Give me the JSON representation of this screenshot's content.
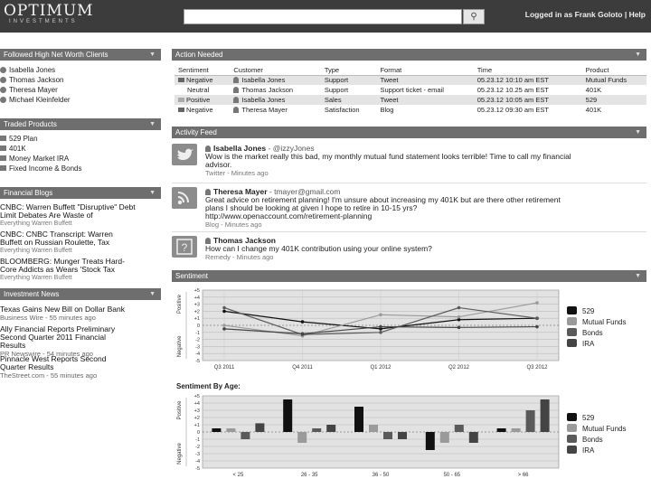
{
  "header": {
    "logo_main": "OPTIMUM",
    "logo_sub": "INVESTMENTS",
    "search_placeholder": "",
    "search_icon": "search-icon",
    "login_text": "Logged in as Frank Goloto | Help"
  },
  "followed_clients": {
    "title": "Followed High Net Worth Clients",
    "items": [
      "Isabella Jones",
      "Thomas Jackson",
      "Theresa Mayer",
      "Michael Kleinfelder"
    ]
  },
  "traded_products": {
    "title": "Traded Products",
    "items": [
      "529 Plan",
      "401K",
      "Money Market IRA",
      "Fixed Income & Bonds"
    ]
  },
  "financial_blogs": {
    "title": "Financial Blogs",
    "items": [
      {
        "title": "CNBC: Warren Buffett \"Disruptive\" Debt",
        "title2": "Limit Debates Are Waste of",
        "source": "Everything Warren Buffett"
      },
      {
        "title": "CNBC: CNBC Transcript: Warren",
        "title2": "Buffett on Russian Roulette, Tax",
        "source": "Everything Warren Buffett"
      },
      {
        "title": "BLOOMBERG: Munger Treats Hard-",
        "title2": "Core Addicts as Wears 'Stock Tax",
        "source": "Everything Warren Buffett"
      }
    ]
  },
  "investment_news": {
    "title": "Investment News",
    "items": [
      {
        "title": "Texas Gains New Bill on Dollar Bank",
        "title2": "",
        "title3": "",
        "source": "Business Wire",
        "time": "55 minutes ago"
      },
      {
        "title": "Ally Financial Reports Preliminary",
        "title2": "Second Quarter 2011 Financial",
        "title3": "Results",
        "source": "PR Newswire",
        "time": "54 minutes ago"
      },
      {
        "title": "Pinnacle West Reports Second",
        "title2": "Quarter Results",
        "title3": "",
        "source": "TheStreet.com",
        "time": "55 minutes ago"
      }
    ]
  },
  "action_needed": {
    "title": "Action Needed",
    "columns": [
      "Sentiment",
      "Customer",
      "Type",
      "Format",
      "Time",
      "Product"
    ],
    "rows": [
      {
        "sentiment": "Negative",
        "customer": "Isabella Jones",
        "type": "Support",
        "format": "Tweet",
        "time": "05.23.12 10:10 am EST",
        "product": "Mutual Funds"
      },
      {
        "sentiment": "Neutral",
        "customer": "Thomas Jackson",
        "type": "Support",
        "format": "Support ticket - email",
        "time": "05.23.12 10.25 am EST",
        "product": "401K"
      },
      {
        "sentiment": "Positive",
        "customer": "Isabella Jones",
        "type": "Sales",
        "format": "Tweet",
        "time": "05.23.12 10:05 am EST",
        "product": "529"
      },
      {
        "sentiment": "Negative",
        "customer": "Theresa Mayer",
        "type": "Satisfaction",
        "format": "Blog",
        "time": "05.23.12 09:30 am EST",
        "product": "401K"
      }
    ]
  },
  "activity_feed": {
    "title": "Activity Feed",
    "items": [
      {
        "name": "Isabella Jones",
        "handle": "- @izzyJones",
        "line1": "Wow is the market really this bad, my monthly mutual fund statement looks terrible! Time to call my financial",
        "line2": "advisor.",
        "line3": "",
        "source": "Twitter",
        "time": "Minutes ago",
        "icon": "twitter-icon"
      },
      {
        "name": "Theresa Mayer",
        "handle": "- tmayer@gmail.com",
        "line1": "Great advice on retirement planning! I'm unsure about increasing my 401K but are there other retirement",
        "line2": "plans I should be looking at given I hope to retire in 10-15 yrs?",
        "line3": "http://www.openaccount.com/retirement-planning",
        "source": "Blog",
        "time": "Minutes ago",
        "icon": "rss-icon"
      },
      {
        "name": "Thomas Jackson",
        "handle": "",
        "line1": "How can I change my 401K contribution using your online system?",
        "line2": "",
        "line3": "",
        "source": "Remedy",
        "time": "Minutes ago",
        "icon": "question-icon"
      }
    ]
  },
  "sentiment": {
    "title": "Sentiment",
    "subtitle2": "Sentiment By Age:",
    "positive_label": "Positive",
    "negative_label": "Negative",
    "y_ticks": [
      "+5",
      "+4",
      "+3",
      "+2",
      "+1",
      "0",
      "-1",
      "-2",
      "-3",
      "-4",
      "-5"
    ],
    "legend": [
      {
        "name": "529",
        "color": "#111111"
      },
      {
        "name": "Mutual Funds",
        "color": "#9a9a9a"
      },
      {
        "name": "Bonds",
        "color": "#5a5a5a"
      },
      {
        "name": "IRA",
        "color": "#444444"
      }
    ]
  },
  "chart_data": [
    {
      "type": "line",
      "title": "Sentiment",
      "categories": [
        "Q3 2011",
        "Q4 2011",
        "Q1 2012",
        "Q2 2012",
        "Q3 2012"
      ],
      "ylim": [
        -5,
        5
      ],
      "series": [
        {
          "name": "529",
          "values": [
            2,
            0.5,
            -0.5,
            0.8,
            1
          ]
        },
        {
          "name": "Mutual Funds",
          "values": [
            0,
            -1.5,
            1.5,
            1.2,
            3.2
          ]
        },
        {
          "name": "Bonds",
          "values": [
            2.5,
            -1.3,
            -1,
            2.5,
            1
          ]
        },
        {
          "name": "IRA",
          "values": [
            -0.5,
            -1.2,
            -0.2,
            -0.3,
            -0.2
          ]
        }
      ]
    },
    {
      "type": "bar",
      "title": "Sentiment By Age:",
      "categories": [
        "< 25",
        "26 - 35",
        "36 - 50",
        "50 - 65",
        "> 66"
      ],
      "ylim": [
        -5,
        5
      ],
      "series": [
        {
          "name": "529",
          "values": [
            0.5,
            4.5,
            3.5,
            -2.5,
            0.5
          ]
        },
        {
          "name": "Mutual Funds",
          "values": [
            0.5,
            -1.5,
            1,
            -1.5,
            0.5
          ]
        },
        {
          "name": "Bonds",
          "values": [
            -1,
            0.5,
            -1,
            1,
            3
          ]
        },
        {
          "name": "IRA",
          "values": [
            1.2,
            1,
            -1,
            -1.5,
            4.5
          ]
        }
      ]
    }
  ]
}
